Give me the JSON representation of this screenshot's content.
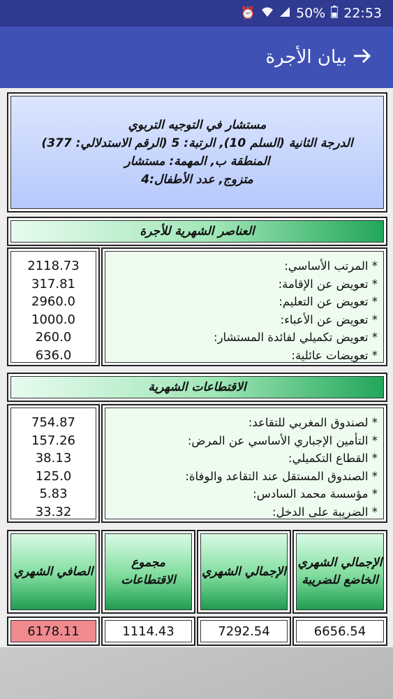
{
  "status_bar": {
    "battery": "50%",
    "time": "22:53",
    "icons": [
      "alarm-icon",
      "wifi-icon",
      "signal-icon",
      "battery-icon"
    ]
  },
  "app_bar": {
    "title": "بيان الأجرة",
    "back_icon": "arrow-right-icon"
  },
  "info": {
    "line1": "مستشار في التوجيه التربوي",
    "line2": "الدرجة الثانية  (السلم 10), الرتبة: 5 (الرقم الاستدلالي: 377)",
    "line3": "المنطقة ب, المهمة: مستشار",
    "line4": "متزوج, عدد الأطفال:4"
  },
  "salary": {
    "header": "العناصر الشهرية للأجرة",
    "items": [
      {
        "label": "* المرتب الأساسي:",
        "value": "2118.73"
      },
      {
        "label": "* تعويض عن الإقامة:",
        "value": "317.81"
      },
      {
        "label": "* تعويض عن التعليم:",
        "value": "2960.0"
      },
      {
        "label": "* تعويض عن الأعباء:",
        "value": "1000.0"
      },
      {
        "label": "* تعويض تكميلي لفائدة المستشار:",
        "value": "260.0"
      },
      {
        "label": "* تعويضات عائلية:",
        "value": "636.0"
      }
    ]
  },
  "deductions": {
    "header": "الاقتطاعات الشهرية",
    "items": [
      {
        "label": "* لصندوق المغربي للتقاعد:",
        "value": "754.87"
      },
      {
        "label": "* التأمين الإجباري الأساسي عن المرض:",
        "value": "157.26"
      },
      {
        "label": "* القطاع التكميلي:",
        "value": "38.13"
      },
      {
        "label": "* الصندوق المستقل عند التقاعد والوفاة:",
        "value": "125.0"
      },
      {
        "label": "* مؤسسة محمد السادس:",
        "value": "5.83"
      },
      {
        "label": "* الضريبة على الدخل:",
        "value": "33.32"
      }
    ]
  },
  "summary": {
    "headers": [
      "الإجمالي الشهري الخاضع للضريبة",
      "الإجمالي الشهري",
      "مجموع الاقتطاعات",
      "الصافي الشهري"
    ],
    "values": [
      "6656.54",
      "7292.54",
      "1114.43",
      "6178.11"
    ],
    "highlight_color": "#f08a8f"
  }
}
